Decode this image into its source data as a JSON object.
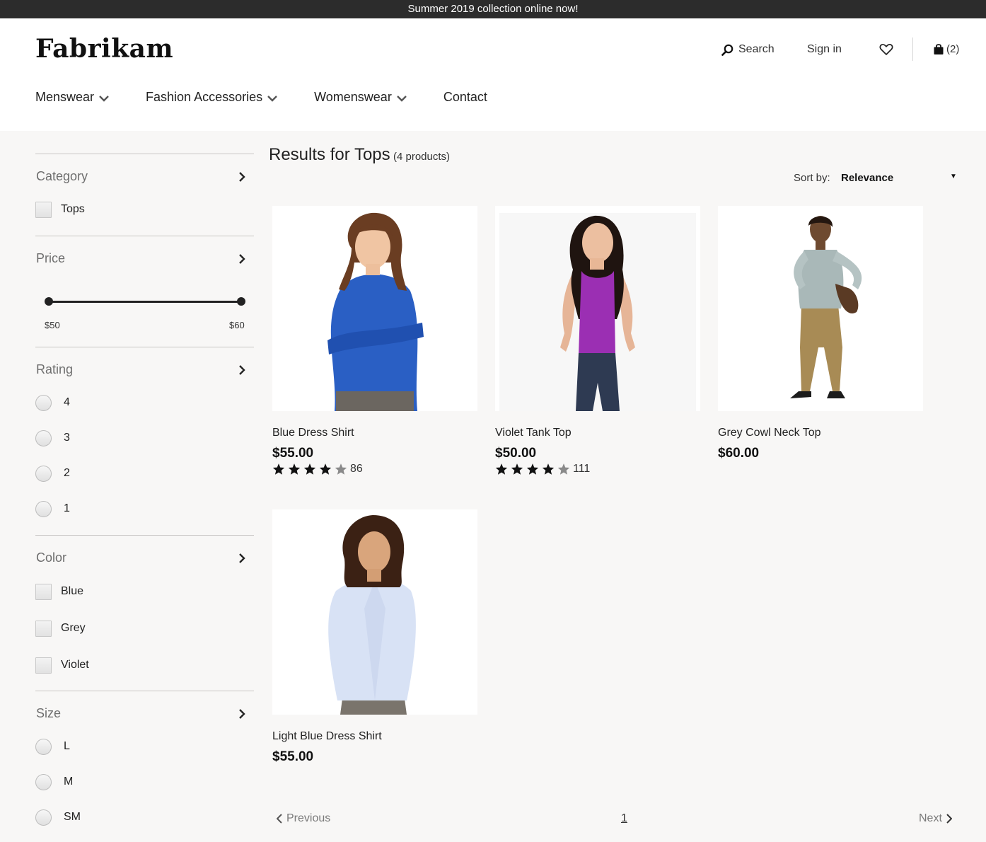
{
  "promo": {
    "text": "Summer 2019 collection online now!"
  },
  "header": {
    "logo": "Fabrikam",
    "search_label": "Search",
    "signin_label": "Sign in",
    "cart_count": "(2)"
  },
  "nav": {
    "items": [
      {
        "label": "Menswear"
      },
      {
        "label": "Fashion Accessories"
      },
      {
        "label": "Womenswear"
      },
      {
        "label": "Contact"
      }
    ]
  },
  "filters": {
    "category": {
      "title": "Category",
      "options": [
        "Tops"
      ]
    },
    "price": {
      "title": "Price",
      "min_label": "$50",
      "max_label": "$60"
    },
    "rating": {
      "title": "Rating",
      "options": [
        "4",
        "3",
        "2",
        "1"
      ]
    },
    "color": {
      "title": "Color",
      "options": [
        "Blue",
        "Grey",
        "Violet"
      ]
    },
    "size": {
      "title": "Size",
      "options": [
        "L",
        "M",
        "SM"
      ]
    }
  },
  "results": {
    "title": "Results for Tops",
    "count": "(4 products)",
    "sort_label": "Sort by:",
    "sort_value": "Relevance"
  },
  "products": [
    {
      "name": "Blue Dress Shirt",
      "price": "$55.00",
      "rating": 4,
      "reviews": "86"
    },
    {
      "name": "Violet Tank Top",
      "price": "$50.00",
      "rating": 4,
      "reviews": "111"
    },
    {
      "name": "Grey Cowl Neck Top",
      "price": "$60.00"
    },
    {
      "name": "Light Blue Dress Shirt",
      "price": "$55.00"
    }
  ],
  "pagination": {
    "prev": "Previous",
    "current": "1",
    "next": "Next"
  },
  "colors": {
    "promo_bg": "#2c2c2c",
    "page_bg": "#f8f7f6",
    "shirt_blue": "#2a5fc4",
    "tank_violet": "#9b2fb3",
    "cowl_grey": "#a9b8b8",
    "light_blue": "#d8e2f5"
  }
}
